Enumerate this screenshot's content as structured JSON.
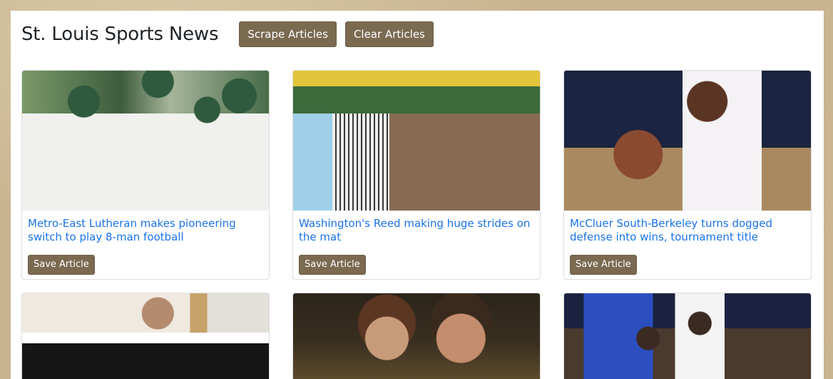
{
  "header": {
    "title": "St. Louis Sports News",
    "scrape_label": "Scrape Articles",
    "clear_label": "Clear Articles"
  },
  "articles": [
    {
      "title": "Metro-East Lutheran makes pioneering switch to play 8-man football",
      "save_label": "Save Article"
    },
    {
      "title": "Washington's Reed making huge strides on the mat",
      "save_label": "Save Article"
    },
    {
      "title": "McCluer South-Berkeley turns dogged defense into wins, tournament title",
      "save_label": "Save Article"
    },
    {
      "title": "",
      "save_label": ""
    },
    {
      "title": "",
      "save_label": ""
    },
    {
      "title": "",
      "save_label": ""
    }
  ],
  "colors": {
    "accent_button": "#7a6a50",
    "link": "#1a73e8"
  }
}
